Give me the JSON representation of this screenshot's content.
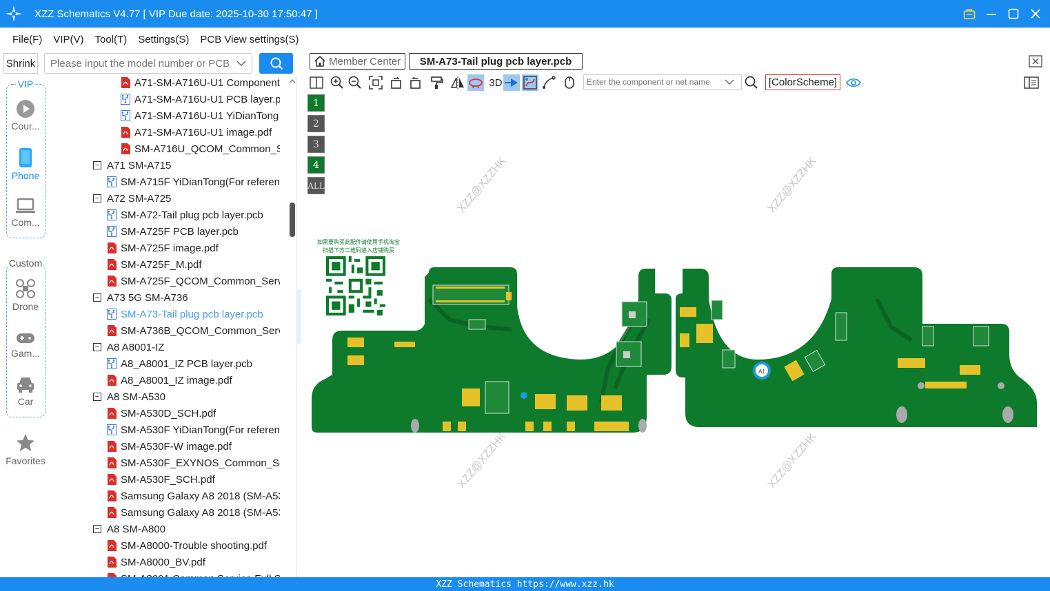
{
  "window": {
    "title": "XZZ Schematics V4.77 [ VIP Due date: 2025-10-30 17:50:47 ]",
    "accent": "#1a8cf0"
  },
  "menu": [
    "File(F)",
    "VIP(V)",
    "Tool(T)",
    "Settings(S)",
    "PCB View settings(S)"
  ],
  "search": {
    "shrink_label": "Shrink",
    "placeholder": "Please input the model number or PCB"
  },
  "nav": {
    "vip_label": "VIP",
    "custom_label": "Custom",
    "items": [
      {
        "label": "Cour...",
        "icon": "play-icon"
      },
      {
        "label": "Phone",
        "icon": "phone-icon"
      },
      {
        "label": "Com...",
        "icon": "laptop-icon"
      },
      {
        "label": "Drone",
        "icon": "drone-icon"
      },
      {
        "label": "Gam...",
        "icon": "gamepad-icon"
      },
      {
        "label": "Car",
        "icon": "car-icon"
      },
      {
        "label": "Favorites",
        "icon": "star-icon"
      }
    ]
  },
  "tree": [
    {
      "label": "A71-SM-A716U-U1 Component",
      "type": "pdf",
      "level": 2
    },
    {
      "label": "A71-SM-A716U-U1 PCB layer.pcb",
      "type": "pcb",
      "level": 2
    },
    {
      "label": "A71-SM-A716U-U1 YiDianTong",
      "type": "pcb",
      "level": 2
    },
    {
      "label": "A71-SM-A716U-U1 image.pdf",
      "type": "pdf",
      "level": 2
    },
    {
      "label": "SM-A716U_QCOM_Common_Se",
      "type": "pdf",
      "level": 2
    },
    {
      "label": "A71 SM-A715",
      "type": "folder",
      "level": 0
    },
    {
      "label": "SM-A715F YiDianTong(For referen",
      "type": "pcb",
      "level": 1
    },
    {
      "label": "A72 SM-A725",
      "type": "folder",
      "level": 0
    },
    {
      "label": "SM-A72-Tail plug pcb layer.pcb",
      "type": "pcb",
      "level": 1
    },
    {
      "label": "SM-A725F PCB layer.pcb",
      "type": "pcb",
      "level": 1
    },
    {
      "label": "SM-A725F image.pdf",
      "type": "pdf",
      "level": 1
    },
    {
      "label": "SM-A725F_M.pdf",
      "type": "pdf",
      "level": 1
    },
    {
      "label": "SM-A725F_QCOM_Common_Servic",
      "type": "pdf",
      "level": 1
    },
    {
      "label": "A73 5G SM-A736",
      "type": "folder",
      "level": 0
    },
    {
      "label": "SM-A73-Tail plug pcb layer.pcb",
      "type": "pcb",
      "level": 1,
      "selected": true
    },
    {
      "label": "SM-A736B_QCOM_Common_Servic",
      "type": "pdf",
      "level": 1
    },
    {
      "label": "A8 A8001-IZ",
      "type": "folder",
      "level": 0
    },
    {
      "label": "A8_A8001_IZ PCB layer.pcb",
      "type": "pcb",
      "level": 1
    },
    {
      "label": "A8_A8001_IZ image.pdf",
      "type": "pdf",
      "level": 1
    },
    {
      "label": "A8 SM-A530",
      "type": "folder",
      "level": 0
    },
    {
      "label": "SM-A530D_SCH.pdf",
      "type": "pdf",
      "level": 1
    },
    {
      "label": "SM-A530F YiDianTong(For referen",
      "type": "pcb",
      "level": 1
    },
    {
      "label": "SM-A530F-W image.pdf",
      "type": "pdf",
      "level": 1
    },
    {
      "label": "SM-A530F_EXYNOS_Common_Serv",
      "type": "pdf",
      "level": 1
    },
    {
      "label": "SM-A530F_SCH.pdf",
      "type": "pdf",
      "level": 1
    },
    {
      "label": "Samsung Galaxy A8 2018 (SM-A53",
      "type": "pdf",
      "level": 1
    },
    {
      "label": "Samsung Galaxy A8 2018 (SM-A53",
      "type": "pdf",
      "level": 1
    },
    {
      "label": "A8 SM-A800",
      "type": "folder",
      "level": 0
    },
    {
      "label": "SM-A8000-Trouble shooting.pdf",
      "type": "pdf",
      "level": 1
    },
    {
      "label": "SM-A8000_BV.pdf",
      "type": "pdf",
      "level": 1
    },
    {
      "label": "SM-A8001 Common Service Full S",
      "type": "pdf",
      "level": 1
    }
  ],
  "tabs": {
    "home_label": "Member Center",
    "file_label": "SM-A73-Tail plug pcb layer.pcb"
  },
  "pcb_toolbar": {
    "three_d_label": "3D",
    "search_placeholder": "Enter the component or net name",
    "color_scheme_label": "[ColorScheme]"
  },
  "layers": [
    {
      "label": "1",
      "active": true
    },
    {
      "label": "2",
      "active": false
    },
    {
      "label": "3",
      "active": false
    },
    {
      "label": "4",
      "active": true
    },
    {
      "label": "ALL",
      "active": false
    }
  ],
  "canvas": {
    "watermark": "XZZ@XZZHK",
    "qr_caption_line1": "如需要购买此配件请使用手机淘宝",
    "qr_caption_line2": "扫描下方二维码进入店铺购买",
    "component_label": "A1",
    "board_color": "#0e7a2c"
  },
  "status": {
    "text": "XZZ Schematics https://www.xzz.hk"
  }
}
